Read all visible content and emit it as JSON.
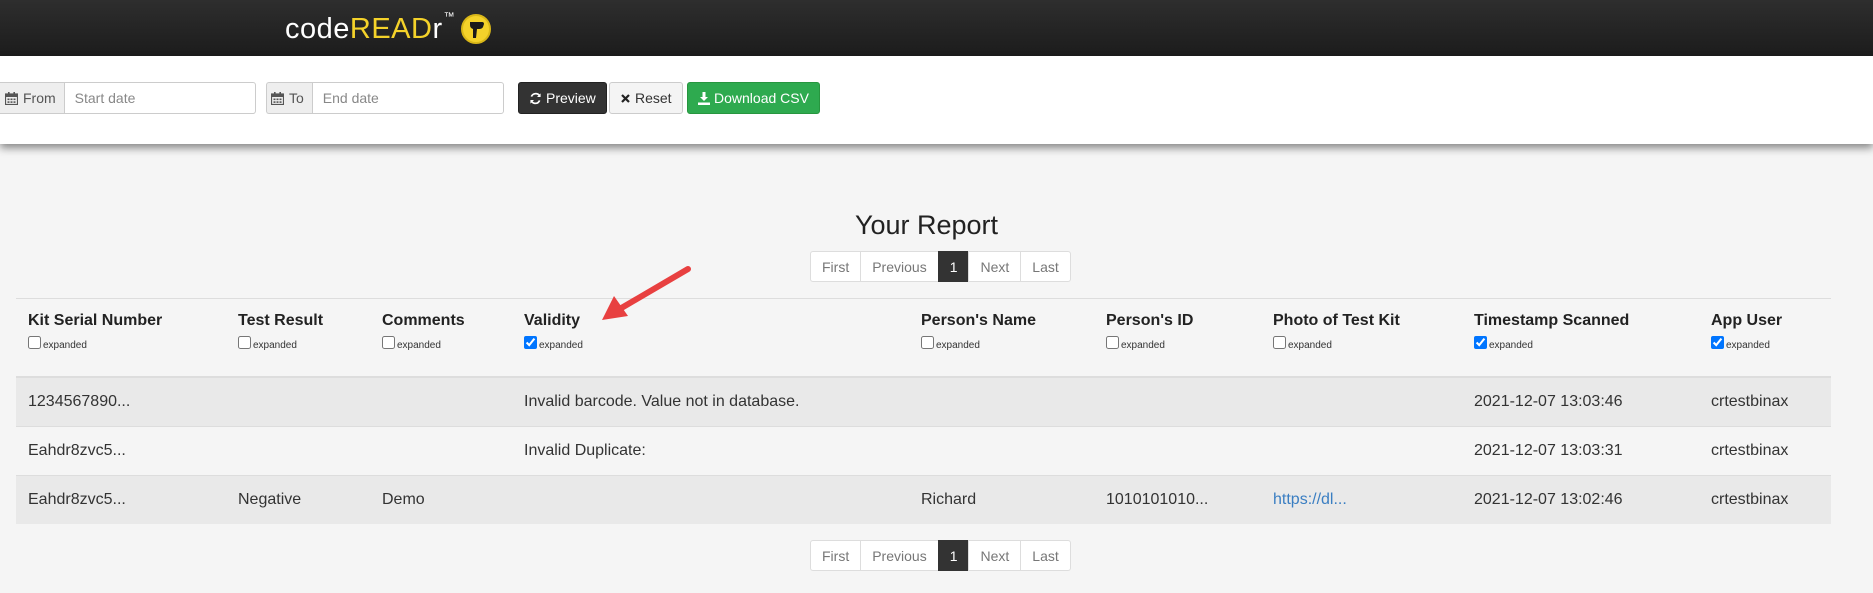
{
  "header": {
    "logo_code": "code",
    "logo_read": "READ",
    "logo_r": "r",
    "logo_tm": "™"
  },
  "toolbar": {
    "from_label": "From",
    "from_placeholder": "Start date",
    "to_label": "To",
    "to_placeholder": "End date",
    "preview_label": "Preview",
    "reset_label": "Reset",
    "download_label": "Download CSV"
  },
  "report": {
    "title": "Your Report",
    "pagination": {
      "first": "First",
      "previous": "Previous",
      "current": "1",
      "next": "Next",
      "last": "Last"
    },
    "expanded_label": "expanded",
    "columns": [
      {
        "label": "Kit Serial Number",
        "expanded": false
      },
      {
        "label": "Test Result",
        "expanded": false
      },
      {
        "label": "Comments",
        "expanded": false
      },
      {
        "label": "Validity",
        "expanded": true
      },
      {
        "label": "Person's Name",
        "expanded": false
      },
      {
        "label": "Person's ID",
        "expanded": false
      },
      {
        "label": "Photo of Test Kit",
        "expanded": false
      },
      {
        "label": "Timestamp Scanned",
        "expanded": true
      },
      {
        "label": "App User",
        "expanded": true
      }
    ],
    "rows": [
      [
        "1234567890...",
        "",
        "",
        "Invalid barcode. Value not in database.",
        "",
        "",
        "",
        "2021-12-07 13:03:46",
        "crtestbinax"
      ],
      [
        "Eahdr8zvc5...",
        "",
        "",
        "Invalid Duplicate:",
        "",
        "",
        "",
        "2021-12-07 13:03:31",
        "crtestbinax"
      ],
      [
        "Eahdr8zvc5...",
        "Negative",
        "Demo",
        "",
        "Richard",
        "1010101010...",
        "https://dl...",
        "2021-12-07 13:02:46",
        "crtestbinax"
      ]
    ]
  },
  "colors": {
    "header_bg": "#222222",
    "brand_yellow": "#f4d22a",
    "preview_bg": "#333333",
    "download_bg": "#2eaa4f",
    "annotation_arrow": "#e84040",
    "link": "#3a7ec2"
  },
  "icons": [
    "calendar-icon",
    "refresh-icon",
    "close-icon",
    "download-icon",
    "barcode-scanner-logo-icon"
  ]
}
